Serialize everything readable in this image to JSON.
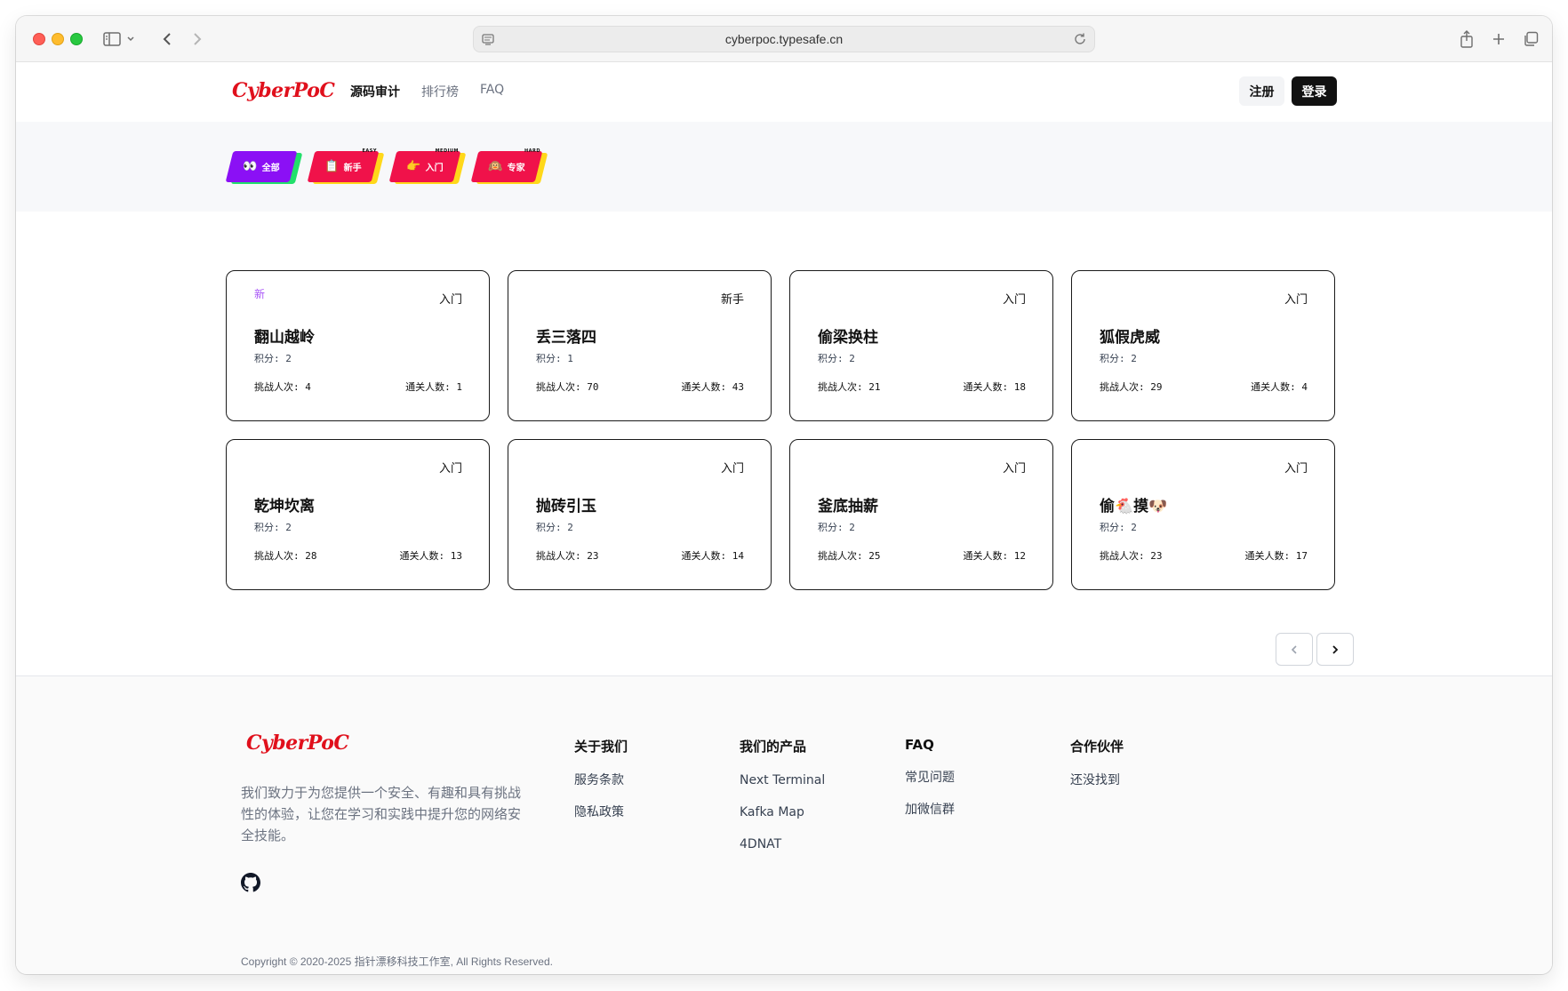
{
  "browser": {
    "url": "cyberpoc.typesafe.cn"
  },
  "nav": {
    "logo": "CyberPoC",
    "links": [
      "源码审计",
      "排行榜",
      "FAQ"
    ],
    "register": "注册",
    "login": "登录"
  },
  "filters": [
    {
      "emoji": "👀",
      "label": "全部",
      "tiny": "",
      "color": "#8b10f5",
      "shadow": "#22e06b"
    },
    {
      "emoji": "📋",
      "label": "新手",
      "tiny": "EASY",
      "color": "#f0124a",
      "shadow": "#ffd81a"
    },
    {
      "emoji": "👉",
      "label": "入门",
      "tiny": "MEDIUM",
      "color": "#f0124a",
      "shadow": "#ffd81a"
    },
    {
      "emoji": "🙉",
      "label": "专家",
      "tiny": "HARD",
      "color": "#f0124a",
      "shadow": "#ffd81a"
    }
  ],
  "cards": [
    {
      "new": "新",
      "level": "入门",
      "title": "翻山越岭",
      "score": "积分: 2",
      "attempts": "挑战人次: 4",
      "passes": "通关人数: 1"
    },
    {
      "new": "",
      "level": "新手",
      "title": "丢三落四",
      "score": "积分: 1",
      "attempts": "挑战人次: 70",
      "passes": "通关人数: 43"
    },
    {
      "new": "",
      "level": "入门",
      "title": "偷梁换柱",
      "score": "积分: 2",
      "attempts": "挑战人次: 21",
      "passes": "通关人数: 18"
    },
    {
      "new": "",
      "level": "入门",
      "title": "狐假虎威",
      "score": "积分: 2",
      "attempts": "挑战人次: 29",
      "passes": "通关人数: 4"
    },
    {
      "new": "",
      "level": "入门",
      "title": "乾坤坎离",
      "score": "积分: 2",
      "attempts": "挑战人次: 28",
      "passes": "通关人数: 13"
    },
    {
      "new": "",
      "level": "入门",
      "title": "抛砖引玉",
      "score": "积分: 2",
      "attempts": "挑战人次: 23",
      "passes": "通关人数: 14"
    },
    {
      "new": "",
      "level": "入门",
      "title": "釜底抽薪",
      "score": "积分: 2",
      "attempts": "挑战人次: 25",
      "passes": "通关人数: 12"
    },
    {
      "new": "",
      "level": "入门",
      "title": "偷🐔摸🐶",
      "score": "积分: 2",
      "attempts": "挑战人次: 23",
      "passes": "通关人数: 17"
    }
  ],
  "footer": {
    "logo": "CyberPoC",
    "description": "我们致力于为您提供一个安全、有趣和具有挑战性的体验，让您在学习和实践中提升您的网络安全技能。",
    "columns": [
      {
        "title": "关于我们",
        "links": [
          "服务条款",
          "隐私政策"
        ]
      },
      {
        "title": "我们的产品",
        "links": [
          "Next Terminal",
          "Kafka Map",
          "4DNAT"
        ]
      },
      {
        "title": "FAQ",
        "links": [
          "常见问题",
          "加微信群"
        ]
      },
      {
        "title": "合作伙伴",
        "links": [
          "还没找到"
        ]
      }
    ],
    "copyright": "Copyright © 2020-2025 指针漂移科技工作室, All Rights Reserved."
  }
}
